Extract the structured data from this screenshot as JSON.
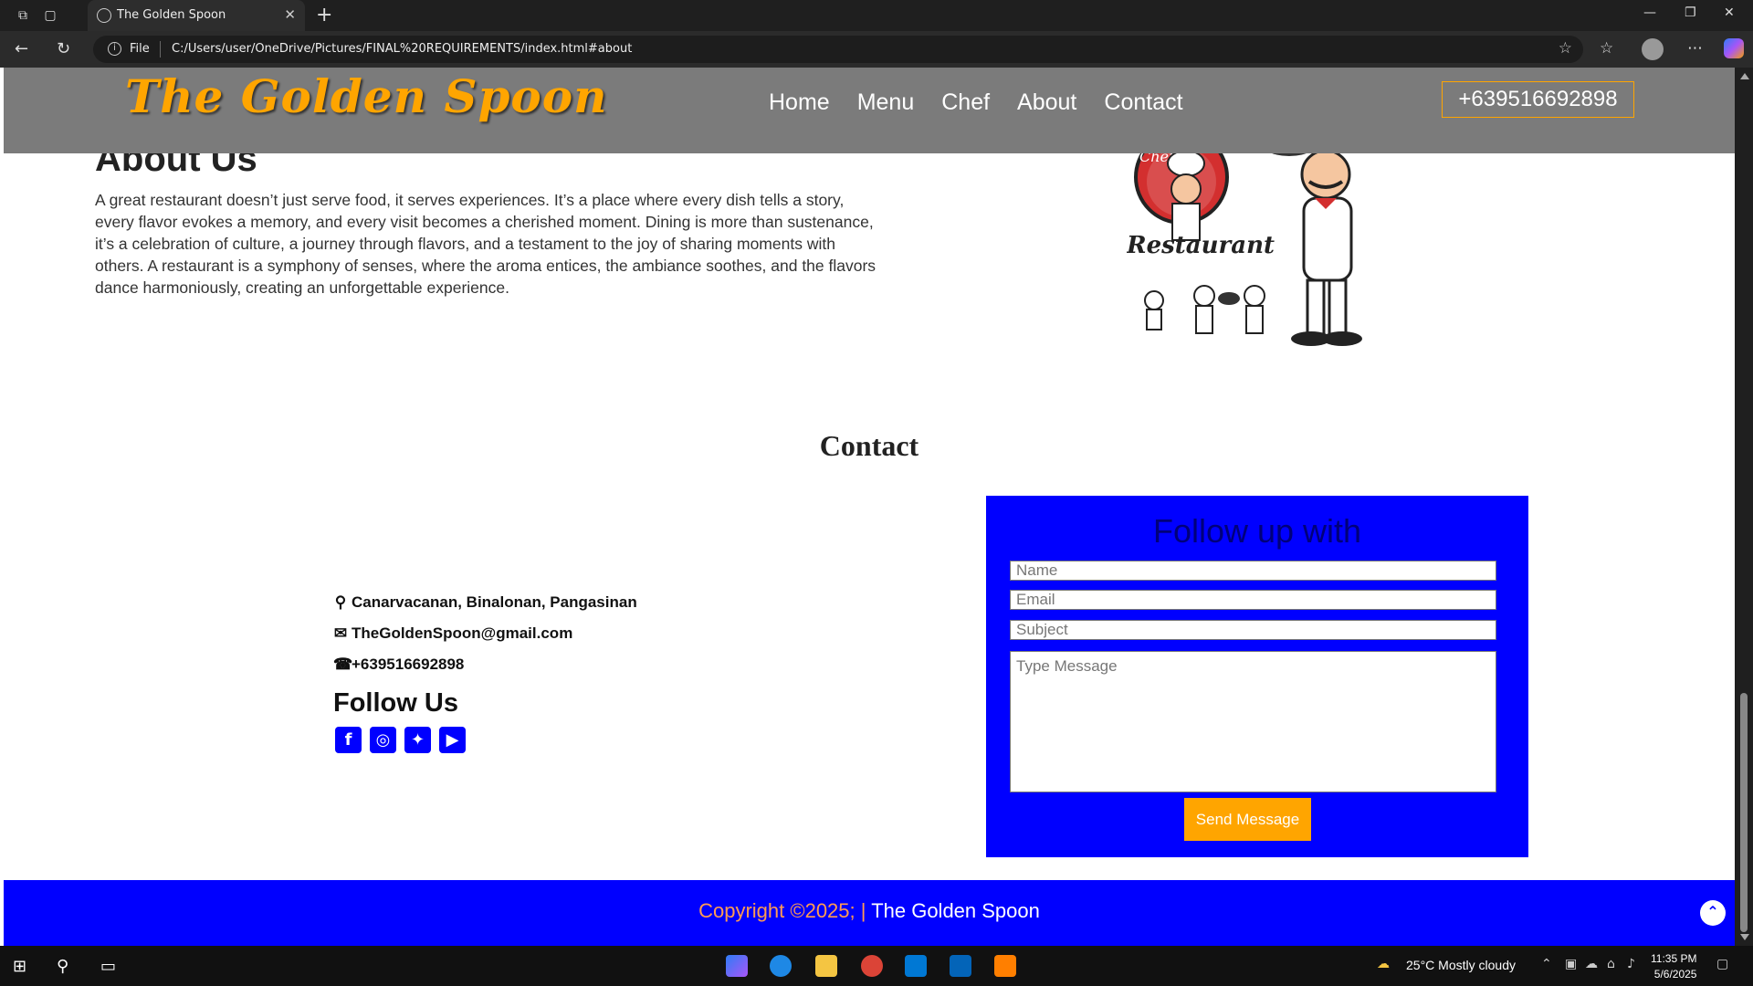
{
  "browser": {
    "tab_title": "The Golden Spoon",
    "address_scheme": "File",
    "url": "C:/Users/user/OneDrive/Pictures/FINAL%20REQUIREMENTS/index.html#about"
  },
  "site": {
    "logo": "The Golden Spoon",
    "nav": [
      "Home",
      "Menu",
      "Chef",
      "About",
      "Contact"
    ],
    "phone_button": "+639516692898"
  },
  "about": {
    "title": "About Us",
    "text": "A great restaurant doesn’t just serve food, it serves experiences. It’s a place where every dish tells a story, every flavor evokes a memory, and every visit becomes a cherished moment. Dining is more than sustenance, it’s a celebration of culture, a journey through flavors, and a testament to the joy of sharing moments with others. A restaurant is a symphony of senses, where the aroma entices, the ambiance soothes, and the flavors dance harmoniously, creating an unforgettable experience.",
    "image_text": "Restaurant",
    "image_badge": "Chef"
  },
  "contact": {
    "title": "Contact",
    "address": "Canarvacanan, Binalonan, Pangasinan",
    "email": "TheGoldenSpoon@gmail.com",
    "phone": "+639516692898",
    "follow_title": "Follow Us",
    "socials": [
      "facebook-icon",
      "instagram-icon",
      "twitter-icon",
      "youtube-icon"
    ]
  },
  "form": {
    "title": "Follow up with",
    "name_placeholder": "Name",
    "email_placeholder": "Email",
    "subject_placeholder": "Subject",
    "message_placeholder": "Type Message",
    "send_label": "Send Message"
  },
  "footer": {
    "copyright": "Copyright ©2025; |",
    "brand": "The Golden Spoon"
  },
  "taskbar": {
    "weather": "25°C  Mostly cloudy",
    "time": "11:35 PM",
    "date": "5/6/2025"
  },
  "colors": {
    "brand_orange": "#ffa500",
    "brand_blue": "#0000ff",
    "header_gray": "#7b7b7b"
  }
}
